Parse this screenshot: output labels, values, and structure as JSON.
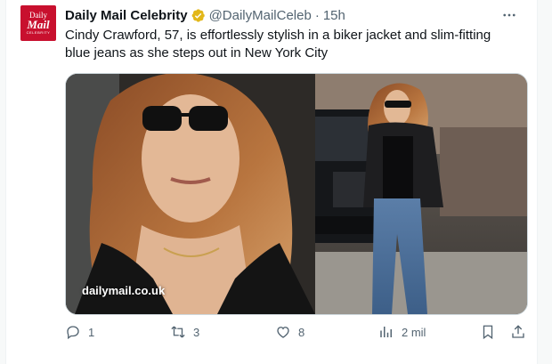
{
  "account": {
    "avatar_lines": [
      "Daily",
      "Mail",
      "CELEBRITY"
    ],
    "name": "Daily Mail Celebrity",
    "handle": "@DailyMailCeleb",
    "separator": "·",
    "time": "15h",
    "verified_color": "#e2b719"
  },
  "tweet": {
    "text": "Cindy Crawford, 57, is effortlessly stylish in a biker jacket and slim-fitting blue jeans as she steps out in New York City"
  },
  "media": {
    "watermark": "dailymail.co.uk"
  },
  "actions": {
    "replies": "1",
    "retweets": "3",
    "likes": "8",
    "views": "2 mil"
  },
  "icons": {
    "more": "more-icon",
    "reply": "reply-icon",
    "retweet": "retweet-icon",
    "like": "heart-icon",
    "views": "views-icon",
    "bookmark": "bookmark-icon",
    "share": "share-icon"
  },
  "colors": {
    "brand": "#c8102e",
    "secondary_text": "#536471",
    "primary_text": "#0f1419"
  }
}
